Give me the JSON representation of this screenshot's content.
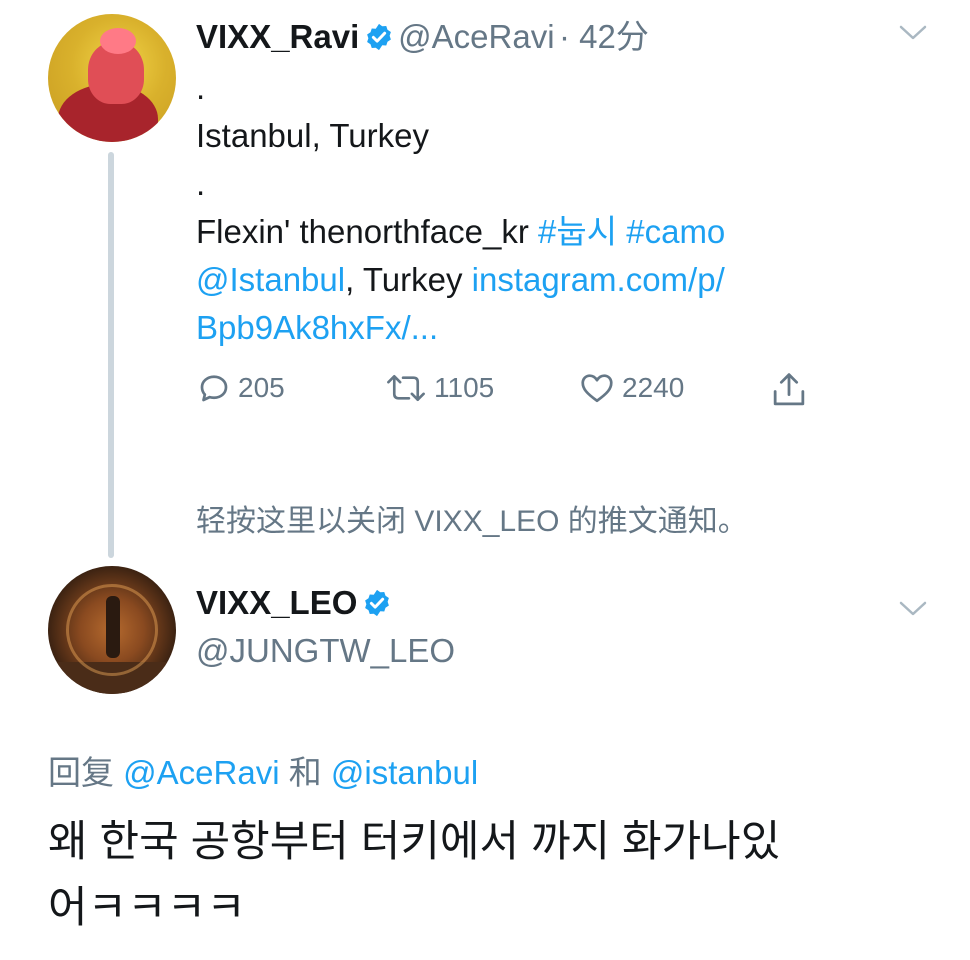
{
  "tweet1": {
    "display_name": "VIXX_Ravi",
    "handle": "@AceRavi",
    "time": "· 42分",
    "lines": {
      "dot1": ".",
      "location": "Istanbul, Turkey",
      "dot2": ".",
      "flex": "Flexin' thenorthface_kr ",
      "hashtag1": "#눕시",
      "hashtag2": "#camo",
      "mention": "@Istanbul",
      "after_mention": ", Turkey ",
      "link_part1": "instagram.com/p/",
      "link_part2": "Bpb9Ak8hxFx/..."
    },
    "replies": "205",
    "retweets": "1105",
    "likes": "2240"
  },
  "notification_notice": "轻按这里以关闭 VIXX_LEO 的推文通知。",
  "tweet2": {
    "display_name": "VIXX_LEO",
    "handle": "@JUNGTW_LEO",
    "reply_label": "回复",
    "reply_user1": "@AceRavi",
    "reply_and": "和",
    "reply_user2": "@istanbul",
    "text_line1": "왜 한국 공항부터 터키에서 까지 화가나있",
    "text_line2": "어ㅋㅋㅋㅋ"
  },
  "colors": {
    "accent": "#1da1f2",
    "muted": "#657786",
    "text": "#14171a",
    "thread": "#ccd6dd"
  },
  "icons": [
    "verified-icon",
    "chevron-down-icon",
    "reply-icon",
    "retweet-icon",
    "like-icon",
    "share-icon"
  ]
}
